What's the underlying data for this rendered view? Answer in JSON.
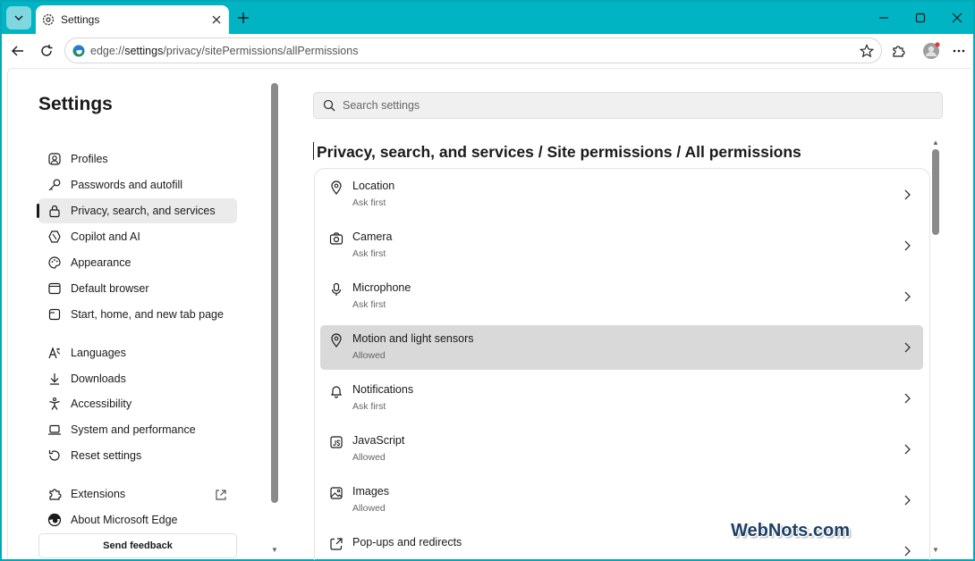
{
  "browser": {
    "tab_title": "Settings",
    "url_prefix": "edge://",
    "url_host": "settings",
    "url_path": "/privacy/sitePermissions/allPermissions"
  },
  "sidebar": {
    "title": "Settings",
    "items": [
      {
        "label": "Profiles",
        "icon": "profile-icon"
      },
      {
        "label": "Passwords and autofill",
        "icon": "key-icon"
      },
      {
        "label": "Privacy, search, and services",
        "icon": "lock-icon",
        "active": true
      },
      {
        "label": "Copilot and AI",
        "icon": "copilot-icon"
      },
      {
        "label": "Appearance",
        "icon": "palette-icon"
      },
      {
        "label": "Default browser",
        "icon": "browser-icon"
      },
      {
        "label": "Start, home, and new tab page",
        "icon": "home-icon"
      },
      {
        "label": "Languages",
        "icon": "language-icon"
      },
      {
        "label": "Downloads",
        "icon": "download-icon"
      },
      {
        "label": "Accessibility",
        "icon": "accessibility-icon"
      },
      {
        "label": "System and performance",
        "icon": "laptop-icon"
      },
      {
        "label": "Reset settings",
        "icon": "reset-icon"
      },
      {
        "label": "Extensions",
        "icon": "extensions-icon"
      },
      {
        "label": "About Microsoft Edge",
        "icon": "edge-icon"
      }
    ],
    "feedback_label": "Send feedback"
  },
  "main": {
    "search_placeholder": "Search settings",
    "breadcrumb": "Privacy, search, and services / Site permissions / All permissions",
    "permissions": [
      {
        "title": "Location",
        "status": "Ask first",
        "icon": "location-icon"
      },
      {
        "title": "Camera",
        "status": "Ask first",
        "icon": "camera-icon"
      },
      {
        "title": "Microphone",
        "status": "Ask first",
        "icon": "microphone-icon"
      },
      {
        "title": "Motion and light sensors",
        "status": "Allowed",
        "icon": "sensor-icon",
        "highlighted": true
      },
      {
        "title": "Notifications",
        "status": "Ask first",
        "icon": "bell-icon"
      },
      {
        "title": "JavaScript",
        "status": "Allowed",
        "icon": "javascript-icon"
      },
      {
        "title": "Images",
        "status": "Allowed",
        "icon": "image-icon"
      },
      {
        "title": "Pop-ups and redirects",
        "status": "",
        "icon": "popup-icon"
      }
    ]
  },
  "watermark": "WebNots.com",
  "colors": {
    "tabbar": "#00b4c4",
    "highlight": "#d9d9d9"
  }
}
